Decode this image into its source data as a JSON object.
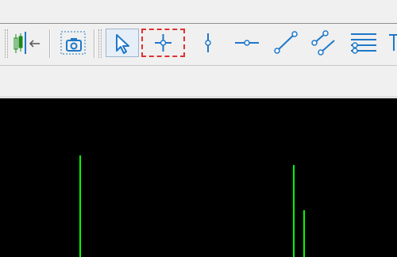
{
  "colors": {
    "chrome_bg": "#f0f0f0",
    "icon_blue": "#1e78c8",
    "chart_bg": "#000000",
    "candle_green": "#00ff00",
    "highlight_red": "#e03030"
  },
  "toolbar": {
    "buttons": [
      {
        "name": "chart-shift-button",
        "icon": "chart-shift-icon"
      },
      {
        "name": "screenshot-button",
        "icon": "camera-icon"
      },
      {
        "name": "cursor-button",
        "icon": "cursor-arrow-icon",
        "state": "pressed"
      },
      {
        "name": "crosshair-button",
        "icon": "crosshair-icon",
        "state": "highlighted"
      },
      {
        "name": "vertical-line-button",
        "icon": "vertical-line-icon"
      },
      {
        "name": "horizontal-line-button",
        "icon": "horizontal-line-icon"
      },
      {
        "name": "trendline-button",
        "icon": "trendline-icon"
      },
      {
        "name": "equidistant-channel-button",
        "icon": "channel-icon"
      },
      {
        "name": "fibonacci-button",
        "icon": "fibonacci-icon"
      }
    ]
  },
  "chart": {
    "bars": [
      {
        "id": "bar-1",
        "direction": "up"
      },
      {
        "id": "bar-2",
        "direction": "up"
      },
      {
        "id": "bar-3",
        "direction": "up"
      }
    ]
  }
}
